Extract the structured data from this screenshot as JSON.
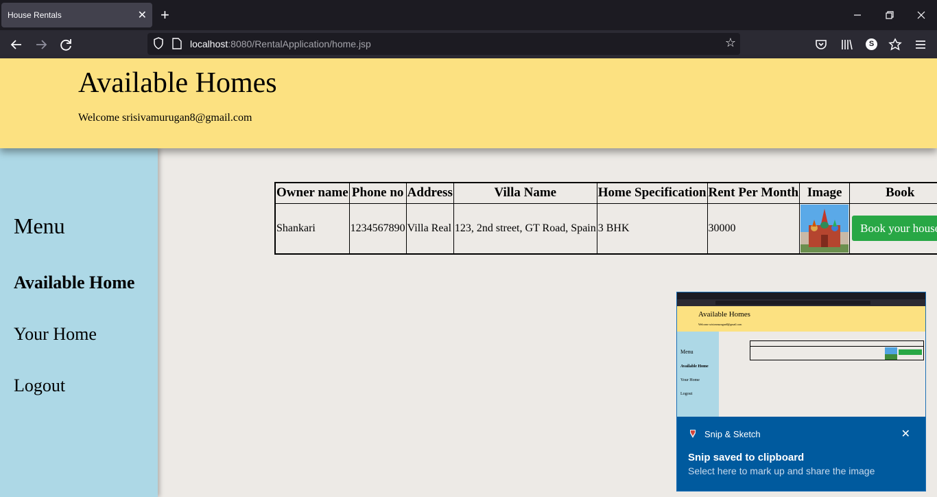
{
  "browser": {
    "tab_title": "House Rentals",
    "tab_close": "✕",
    "new_tab": "+",
    "url_host": "localhost",
    "url_rest": ":8080/RentalApplication/home.jsp",
    "profile_initial": "S",
    "window_controls": [
      "minimize-icon",
      "restore-icon",
      "close-icon"
    ]
  },
  "header": {
    "title": "Available Homes",
    "welcome": "Welcome srisivamurugan8@gmail.com"
  },
  "sidebar": {
    "menu_title": "Menu",
    "items": [
      {
        "label": "Available Home",
        "active": true
      },
      {
        "label": "Your Home",
        "active": false
      },
      {
        "label": "Logout",
        "active": false
      }
    ]
  },
  "table": {
    "headers": [
      "Owner name",
      "Phone no",
      "Address",
      "Villa Name",
      "Home Specification",
      "Rent Per Month",
      "Image",
      "Book"
    ],
    "rows": [
      {
        "owner": "Shankari",
        "phone": "1234567890",
        "address": "Villa Real",
        "villa": "123, 2nd street, GT Road, Spain",
        "spec": "3 BHK",
        "rent": "30000",
        "image": "house-image",
        "book_label": "Book your house"
      }
    ]
  },
  "notification": {
    "app": "Snip & Sketch",
    "title": "Snip saved to clipboard",
    "body": "Select here to mark up and share the image",
    "thumbnail": {
      "header_title": "Available Homes",
      "welcome": "Welcome srisivamurugan8@gmail.com",
      "menu": "Menu",
      "items": [
        "Available Home",
        "Your Home",
        "Logout"
      ]
    }
  },
  "colors": {
    "header_bg": "#fce181",
    "sidebar_bg": "#add8e6",
    "book_button": "#28a745",
    "toast_bg": "#005a9e"
  }
}
